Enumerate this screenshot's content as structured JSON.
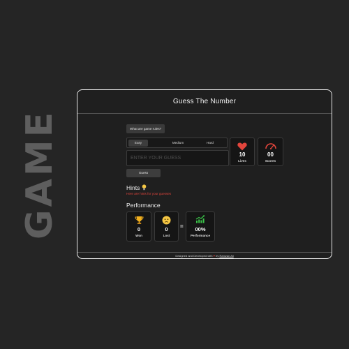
{
  "side_label": "GAME",
  "app": {
    "title": "Guess The Number"
  },
  "rules_button": "What are game rules?",
  "difficulty": {
    "options": [
      "Easy",
      "Medium",
      "Hard"
    ],
    "selected": "Easy"
  },
  "guess_input": {
    "placeholder": "ENTER YOUR GUESS",
    "value": ""
  },
  "guess_button": "Guess",
  "stats": {
    "lives": {
      "value": "10",
      "label": "Lives",
      "icon": "heart-icon"
    },
    "scores": {
      "value": "00",
      "label": "Scores",
      "icon": "speedometer-icon"
    }
  },
  "hints": {
    "title": "Hints",
    "icon": "lightbulb-icon",
    "text": "Here are hints for your guesses"
  },
  "performance": {
    "title": "Performance",
    "won": {
      "value": "0",
      "label": "Won",
      "icon": "trophy-icon"
    },
    "lost": {
      "value": "0",
      "label": "Lost",
      "icon": "sad-face-icon"
    },
    "operator": "=",
    "rate": {
      "value": "00%",
      "label": "Performance",
      "icon": "trending-up-chart-icon"
    }
  },
  "footer": {
    "prefix": "Designed and Developed with",
    "connector": "by",
    "author": "Ramzan Ali"
  },
  "colors": {
    "accent_red": "#e2453c",
    "chart_green": "#3cc84a",
    "trophy_gold": "#f2b01e",
    "emoji_yellow": "#f6c744"
  }
}
